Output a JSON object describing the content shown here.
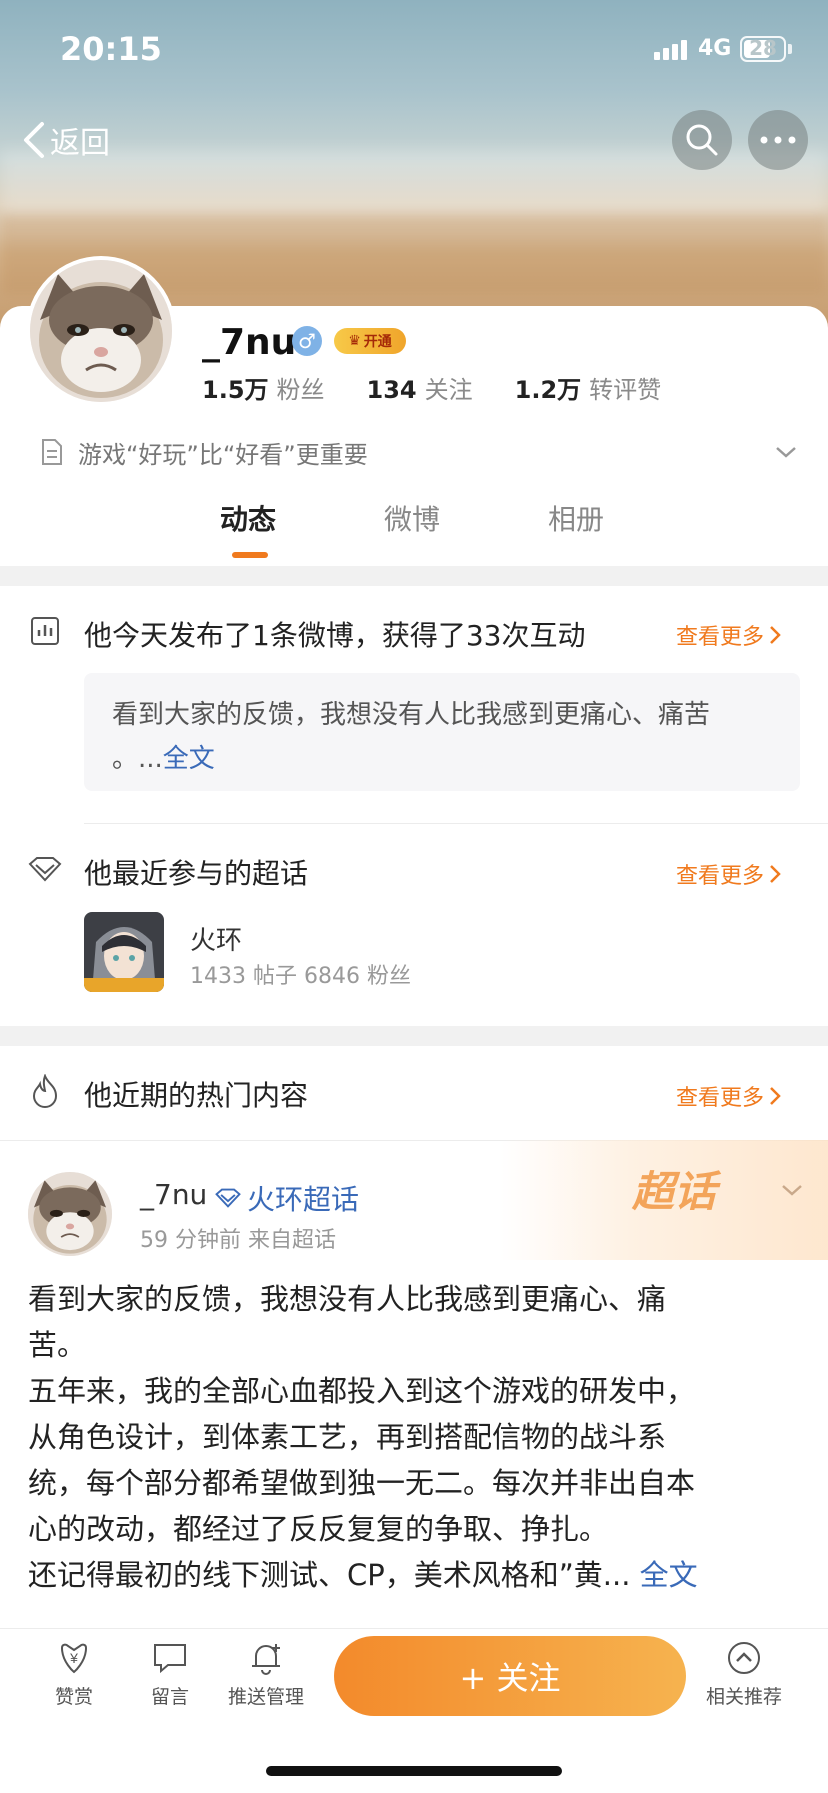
{
  "status": {
    "time": "20:15",
    "network": "4G",
    "battery": "28"
  },
  "nav": {
    "back_label": "返回",
    "search_icon": "search-icon",
    "more_icon": "more-icon"
  },
  "profile": {
    "name": "_7nu",
    "vip_badge": "开通",
    "fans_count": "1.5万",
    "fans_label": "粉丝",
    "following_count": "134",
    "following_label": "关注",
    "interactions_count": "1.2万",
    "interactions_label": "转评赞",
    "bio": "游戏“好玩”比“好看”更重要"
  },
  "tabs": [
    "动态",
    "微博",
    "相册"
  ],
  "today_summary": {
    "text": "他今天发布了1条微博，获得了33次互动",
    "more": "查看更多",
    "quote_line1": "看到大家的反馈，我想没有人比我感到更痛心、痛苦",
    "quote_line2": "。...",
    "quote_link": "全文"
  },
  "super_topic": {
    "title": "他最近参与的超话",
    "more": "查看更多",
    "name": "火环",
    "stats": "1433 帖子  6846 粉丝"
  },
  "hot": {
    "title": "他近期的热门内容",
    "more": "查看更多"
  },
  "post": {
    "user": "_7nu",
    "topic": "火环超话",
    "meta": "59 分钟前   来自超话",
    "watermark": "超话",
    "body_line1": "看到大家的反馈，我想没有人比我感到更痛心、痛",
    "body_line2": "苦。",
    "body_line3": "五年来，我的全部心血都投入到这个游戏的研发中，",
    "body_line4": "从角色设计，到体素工艺，再到搭配信物的战斗系",
    "body_line5": "统，每个部分都希望做到独一无二。每次并非出自本",
    "body_line6": "心的改动，都经过了反反复复的争取、挣扎。",
    "body_line7": "还记得最初的线下测试、CP，美术风格和”黄...",
    "read_more": "全文"
  },
  "bottom": {
    "reward": "赞赏",
    "message": "留言",
    "push": "推送管理",
    "follow": "+ 关注",
    "related": "相关推荐"
  },
  "colors": {
    "accent": "#f07a1e",
    "link": "#3a6ab8"
  }
}
